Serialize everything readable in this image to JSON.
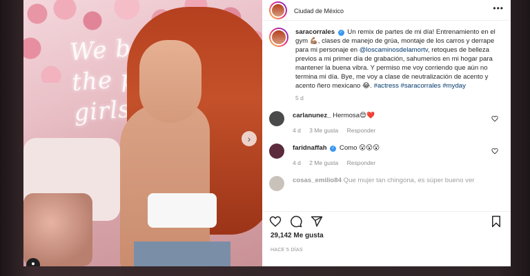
{
  "header": {
    "username": "saracorrales",
    "location": "Ciudad de México",
    "more_label": "•••"
  },
  "neon_sign": "We belong in the power of girls",
  "caption": {
    "username": "saracorrales",
    "text_1": "Un remix de partes de mi día! Entrenamiento en el gym 💪🏽, clases de manejo de grúa, montaje de los carros y derrape para mi personaje en ",
    "mention": "@loscaminosdelamortv",
    "text_2": ", retoques de belleza previos a mi primer día de grabación, sahumerios en mi hogar para mantener la buena vibra. Y permiso me voy corriendo que aún no termina mi día. Bye, me voy a clase de neutralización de acento y acento ñero mexicano 😂. ",
    "hashtags": "#actress #saracorrales #myday",
    "age": "5 d"
  },
  "comments": [
    {
      "username": "carlanunez_",
      "text": "Hermosa😍❤️",
      "age": "4 d",
      "likes": "3 Me gusta",
      "reply": "Responder",
      "avatar_color": "#4a4a4a"
    },
    {
      "username": "faridnaffah",
      "text": "Como 😮😮😮",
      "age": "4 d",
      "likes": "2 Me gusta",
      "reply": "Responder",
      "avatar_color": "#5b2a3c"
    },
    {
      "username": "cosas_emilio84",
      "text": "Que mujer tan chingona, es súper bueno ver"
    }
  ],
  "stats": {
    "likes": "29,142 Me gusta",
    "posted": "HACE 5 DÍAS"
  },
  "colors": {
    "link": "#00376b",
    "secondary_text": "#8e8e8e",
    "verified": "#3897f0",
    "heart": "#ed4956"
  }
}
